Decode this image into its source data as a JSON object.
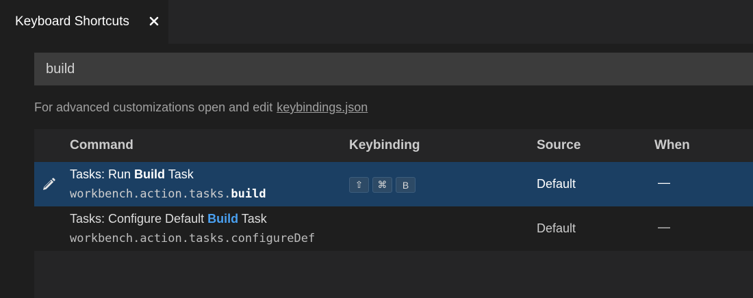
{
  "tab": {
    "label": "Keyboard Shortcuts",
    "close_icon": "close-icon"
  },
  "search": {
    "value": "build",
    "placeholder": "Search keybindings"
  },
  "hint": {
    "text": "For advanced customizations open and edit",
    "link": "keybindings.json"
  },
  "table": {
    "headers": {
      "command": "Command",
      "keybinding": "Keybinding",
      "source": "Source",
      "when": "When"
    },
    "rows": [
      {
        "title_prefix": "Tasks: Run ",
        "title_match": "Build",
        "title_suffix": " Task",
        "command_prefix": "workbench.action.tasks.",
        "command_match": "build",
        "command_suffix": "",
        "keys": [
          "⇧",
          "⌘",
          "B"
        ],
        "source": "Default",
        "when": "—",
        "selected": true,
        "edit_icon": "pencil-icon"
      },
      {
        "title_prefix": "Tasks: Configure Default ",
        "title_match": "Build",
        "title_suffix": " Task",
        "command_prefix": "workbench.action.tasks.configureDef",
        "command_match": "",
        "command_suffix": "",
        "keys": [],
        "source": "Default",
        "when": "—",
        "selected": false
      }
    ]
  },
  "colors": {
    "background": "#1e1e1e",
    "selected_row": "#1b3f63",
    "highlight_blue": "#4aa0f0"
  }
}
